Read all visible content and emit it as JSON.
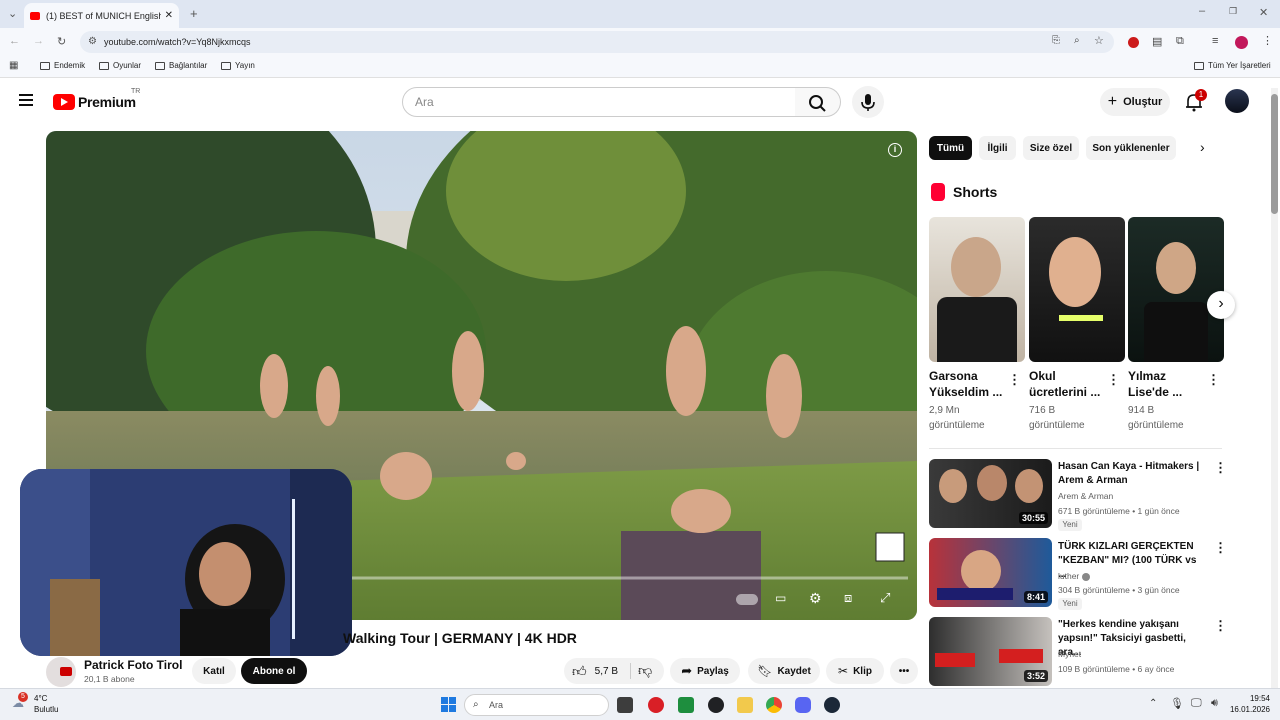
{
  "browser": {
    "tab_title": "(1) BEST of MUNICH English Ga...",
    "url": "youtube.com/watch?v=Yq8Njkxmcqs",
    "bookmarks": [
      "Endemik",
      "Oyunlar",
      "Bağlantılar",
      "Yayın"
    ],
    "all_bookmarks": "Tüm Yer İşaretleri"
  },
  "youtube": {
    "logo_text": "Premium",
    "region": "TR",
    "search_placeholder": "Ara",
    "create_label": "Oluştur",
    "notification_count": "1"
  },
  "player": {
    "title": "Walking Tour | GERMANY | 4K HDR",
    "channel_name": "Patrick Foto Tirol",
    "subscribers": "20,1 B abone",
    "join_label": "Katıl",
    "subscribe_label": "Abone ol",
    "likes": "5,7 B",
    "share_label": "Paylaş",
    "save_label": "Kaydet",
    "clip_label": "Klip"
  },
  "filters": [
    "Tümü",
    "İlgili",
    "Size özel",
    "Son yüklenenler"
  ],
  "shorts": {
    "heading": "Shorts",
    "items": [
      {
        "title1": "Garsona",
        "title2": "Yükseldim ...",
        "views1": "2,9 Mn",
        "views2": "görüntüleme"
      },
      {
        "title1": "Okul",
        "title2": "ücretlerini ...",
        "views1": "716 B",
        "views2": "görüntüleme"
      },
      {
        "title1": "Yılmaz",
        "title2": "Lise'de ...",
        "views1": "914 B",
        "views2": "görüntüleme"
      }
    ]
  },
  "recommended": [
    {
      "title1": "Hasan Can Kaya - Hitmakers |",
      "title2": "Arem & Arman",
      "channel": "Arem & Arman",
      "meta": "671 B görüntüleme  •  1 gün önce",
      "badge": "Yeni",
      "duration": "30:55"
    },
    {
      "title1": "TÜRK KIZLARI GERÇEKTEN",
      "title2": "\"KEZBAN\" MI? (100 TÜRK vs ...",
      "channel": "luther",
      "meta": "304 B görüntüleme  •  3 gün önce",
      "badge": "Yeni",
      "duration": "8:41"
    },
    {
      "title1": "\"Herkes kendine yakışanı",
      "title2": "yapsın!\" Taksiciyi gasbetti, ara...",
      "channel": "Mynet",
      "meta": "109 B görüntüleme  •  6 ay önce",
      "badge": "",
      "duration": "3:52"
    }
  ],
  "taskbar": {
    "temp": "4°C",
    "weather": "Bulutlu",
    "search_placeholder": "Ara",
    "time": "19:54",
    "date": "16.01.2026"
  }
}
